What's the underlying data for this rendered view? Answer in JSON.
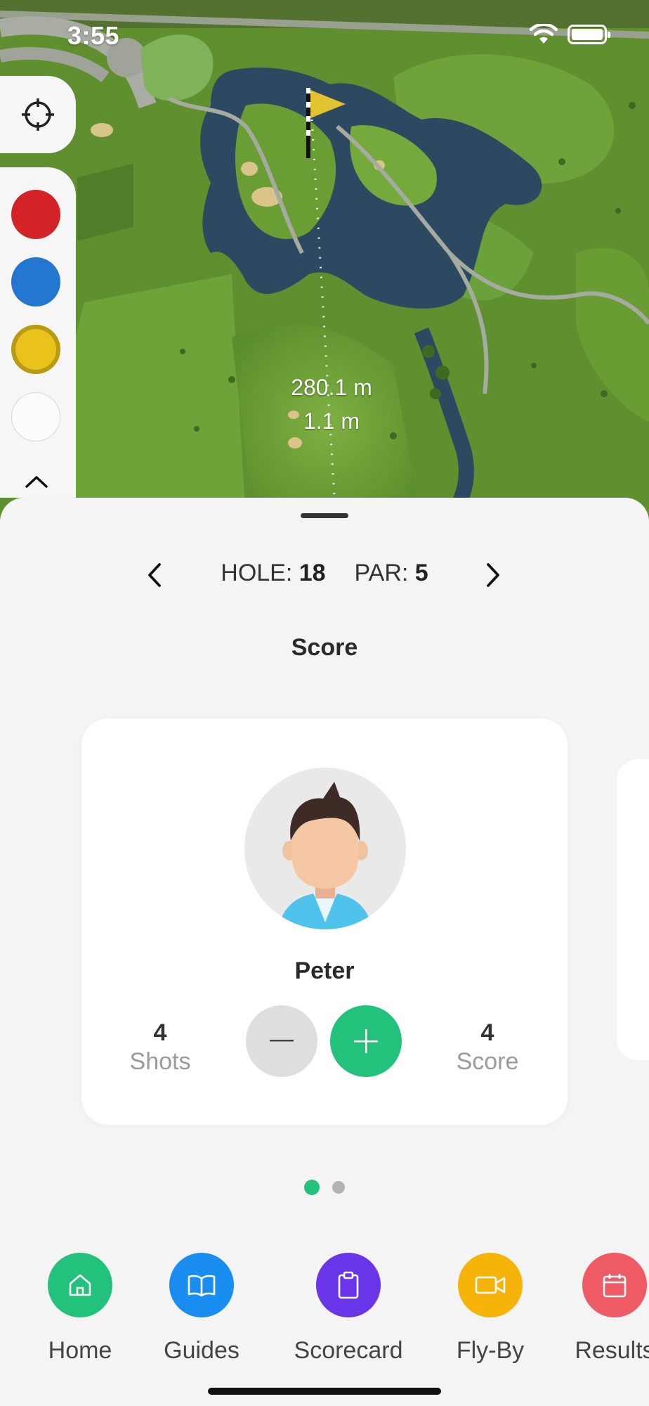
{
  "status_bar": {
    "time": "3:55"
  },
  "map": {
    "distance_to_pin": "280.1 m",
    "distance_secondary": "1.1 m",
    "color_swatches": [
      {
        "name": "red",
        "color": "#d32327"
      },
      {
        "name": "blue",
        "color": "#2377d1"
      },
      {
        "name": "yellow",
        "color": "#e9c21b",
        "selected": true
      },
      {
        "name": "white",
        "color": "#fbfbfb"
      }
    ]
  },
  "hole_nav": {
    "hole_label": "HOLE:",
    "hole_number": "18",
    "par_label": "PAR:",
    "par_value": "5"
  },
  "score_section": {
    "title": "Score",
    "player": {
      "name": "Peter",
      "shots_value": "4",
      "shots_label": "Shots",
      "score_value": "4",
      "score_label": "Score"
    },
    "pagination": {
      "current": 1,
      "total": 2
    }
  },
  "tabs": [
    {
      "label": "Home",
      "icon": "home-icon",
      "color": "#23c27c"
    },
    {
      "label": "Guides",
      "icon": "book-icon",
      "color": "#1a8ef0"
    },
    {
      "label": "Scorecard",
      "icon": "clipboard-icon",
      "color": "#6a35e8"
    },
    {
      "label": "Fly-By",
      "icon": "video-camera-icon",
      "color": "#f6b40b"
    },
    {
      "label": "Results",
      "icon": "calendar-icon",
      "color": "#ee5b64"
    }
  ],
  "colors": {
    "accent_green": "#23c27c",
    "water": "#2d4962",
    "fairway": "#6a9c34"
  }
}
